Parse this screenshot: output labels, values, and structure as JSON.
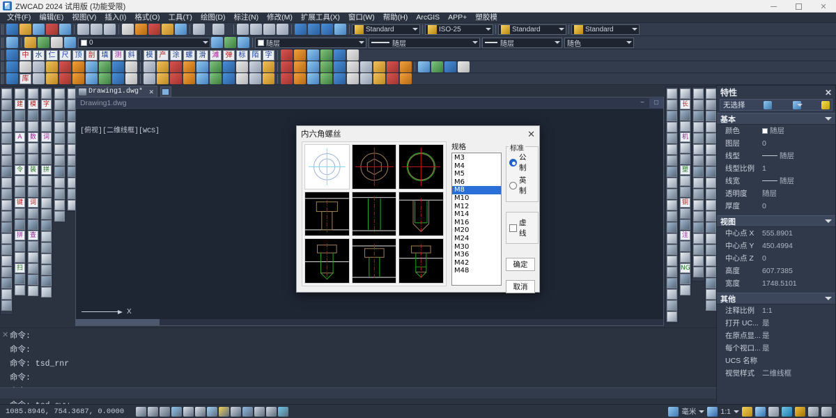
{
  "titlebar": {
    "title": "ZWCAD 2024 试用版 (功能受限)",
    "app_icon": "zwcad-logo-icon",
    "minimize": "−",
    "maximize": "□",
    "close": "✕"
  },
  "menubar": {
    "items": [
      {
        "label": "文件(F)"
      },
      {
        "label": "编辑(E)"
      },
      {
        "label": "视图(V)"
      },
      {
        "label": "插入(I)"
      },
      {
        "label": "格式(O)"
      },
      {
        "label": "工具(T)"
      },
      {
        "label": "绘图(D)"
      },
      {
        "label": "标注(N)"
      },
      {
        "label": "修改(M)"
      },
      {
        "label": "扩展工具(X)"
      },
      {
        "label": "窗口(W)"
      },
      {
        "label": "帮助(H)"
      },
      {
        "label": "ArcGIS"
      },
      {
        "label": "APP+"
      },
      {
        "label": "塑胶模"
      }
    ]
  },
  "toolbar_standard": {
    "style_dropdowns": [
      {
        "name": "text-style",
        "value": "Standard",
        "icon": "text-style-icon"
      },
      {
        "name": "dimension-style",
        "value": "ISO-25",
        "icon": "dimension-style-icon"
      },
      {
        "name": "table-style",
        "value": "Standard",
        "icon": "table-style-icon"
      },
      {
        "name": "multileader-style",
        "value": "Standard",
        "icon": "multileader-style-icon"
      }
    ]
  },
  "toolbar_layer": {
    "layer_name": "0",
    "color": "随层",
    "linetype": "随层",
    "lineweight": "随层",
    "plotstyle": "随色"
  },
  "toolbar_cn_rows": {
    "row3": [
      "中",
      "水",
      "仁",
      "尺",
      "顶",
      "剖",
      "填",
      "测",
      "斜",
      "模",
      "产",
      "涂",
      "螺",
      "滑",
      "滩",
      "弹",
      "标",
      "陌",
      "字"
    ],
    "row5": [
      "库"
    ]
  },
  "drawing_tab": {
    "label": "Drawing1.dwg*",
    "close": "✕",
    "new_tab": "new-tab-icon"
  },
  "drawing_window": {
    "title": "Drawing1.dwg",
    "viewport_label": "[俯视][二维线框][WCS]",
    "axis_label": "X",
    "minimize": "−",
    "maximize": "□"
  },
  "properties": {
    "title": "特性",
    "close": "✕",
    "selection": "无选择",
    "sections": [
      {
        "title": "基本",
        "rows": [
          {
            "key": "颜色",
            "value": "随层",
            "swatch": true
          },
          {
            "key": "图层",
            "value": "0"
          },
          {
            "key": "线型",
            "value": "随层",
            "line": true
          },
          {
            "key": "线型比例",
            "value": "1"
          },
          {
            "key": "线宽",
            "value": "随层",
            "line": true
          },
          {
            "key": "透明度",
            "value": "随层"
          },
          {
            "key": "厚度",
            "value": "0"
          }
        ]
      },
      {
        "title": "视图",
        "rows": [
          {
            "key": "中心点 X",
            "value": "555.8901"
          },
          {
            "key": "中心点 Y",
            "value": "450.4994"
          },
          {
            "key": "中心点 Z",
            "value": "0"
          },
          {
            "key": "高度",
            "value": "607.7385"
          },
          {
            "key": "宽度",
            "value": "1748.5101"
          }
        ]
      },
      {
        "title": "其他",
        "rows": [
          {
            "key": "注释比例",
            "value": "1:1"
          },
          {
            "key": "打开 UC...",
            "value": "是"
          },
          {
            "key": "在原点显...",
            "value": "是"
          },
          {
            "key": "每个视口...",
            "value": "是"
          },
          {
            "key": "UCS 名称",
            "value": ""
          },
          {
            "key": "视觉样式",
            "value": "二维线框"
          }
        ]
      }
    ]
  },
  "command_area": {
    "close": "✕",
    "lines": [
      "命令:",
      "命令:",
      "命令: tsd_rnr",
      "命令:",
      "命令:",
      "命令: tsd_sww"
    ]
  },
  "statusbar": {
    "coordinates": "1085.8946,  754.3687,  0.0000",
    "unit": "毫米",
    "scale": "1:1",
    "icons": [
      "grid-icon",
      "snap-grid-icon",
      "ortho-icon",
      "polar-tracking-icon",
      "osnap-icon",
      "otrack-icon",
      "lineweight-icon",
      "dynamic-input-icon",
      "transparency-icon",
      "quick-properties-icon",
      "selection-cycling-icon",
      "annotation-icon",
      "workspace-icon"
    ],
    "right_icons": [
      "unit-icon",
      "annotation-scale-icon",
      "annotation-visibility-icon",
      "auto-scale-icon",
      "isolate-icon",
      "settings-gear-icon",
      "hardware-accel-icon",
      "clean-screen-icon",
      "customization-icon"
    ]
  },
  "dialog": {
    "title": "内六角螺丝",
    "close": "✕",
    "spec_label": "规格",
    "spec_items": [
      "M3",
      "M4",
      "M5",
      "M6",
      "M8",
      "M10",
      "M12",
      "M14",
      "M16",
      "M20",
      "M24",
      "M30",
      "M36",
      "M42",
      "M48"
    ],
    "spec_selected": "M8",
    "standard_group": "标准",
    "standard_options": [
      {
        "label": "公 制",
        "checked": true
      },
      {
        "label": "英 制",
        "checked": false
      }
    ],
    "dashed_checkbox": {
      "label": "虚 线",
      "checked": false
    },
    "ok_button": "确定",
    "cancel_button": "取消",
    "thumbnails": [
      {
        "name": "top-view-blueprint",
        "style": "light"
      },
      {
        "name": "top-view-hex-socket",
        "style": "dark"
      },
      {
        "name": "top-view-round-head",
        "style": "dark"
      },
      {
        "name": "front-view-socket-cap",
        "style": "dark"
      },
      {
        "name": "front-view-set-screw",
        "style": "dark"
      },
      {
        "name": "front-view-cone-point",
        "style": "dark"
      },
      {
        "name": "front-view-cap-cone",
        "style": "dark"
      },
      {
        "name": "front-view-cap-full",
        "style": "dark"
      },
      {
        "name": "front-view-cap-short",
        "style": "dark"
      }
    ]
  },
  "colors": {
    "accent": "#2a6fd8",
    "panel_bg": "#2f394a",
    "toolbar_bg": "#333c4d",
    "canvas_bg": "#1e2533",
    "dialog_bg": "#f0f0f0"
  }
}
